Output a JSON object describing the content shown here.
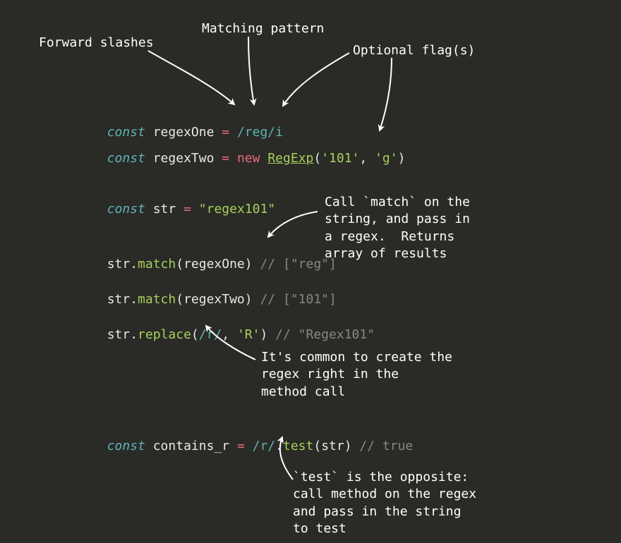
{
  "labels": {
    "forward_slashes": "Forward slashes",
    "matching_pattern": "Matching pattern",
    "optional_flags": "Optional flag(s)",
    "match_note": "Call `match` on the\nstring, and pass in\na regex.  Returns\narray of results",
    "inline_note": "It's common to create the\nregex right in the\nmethod call",
    "test_note": "`test` is the opposite:\ncall method on the regex\nand pass in the string\nto test"
  },
  "code": {
    "const": "const",
    "regexOne": "regexOne",
    "regexTwo": "regexTwo",
    "eq": "=",
    "regex_lit_1": "/reg/i",
    "new": "new",
    "RegExp": "RegExp",
    "lp": "(",
    "rp": ")",
    "comma": ", ",
    "s101": "'101'",
    "sg": "'g'",
    "strVar": "str",
    "strVal": "\"regex101\"",
    "dot": ".",
    "match": "match",
    "replace": "replace",
    "test": "test",
    "regex_r": "/r/",
    "sR": "'R'",
    "c_reg": "// [\"reg\"]",
    "c_101": "// [\"101\"]",
    "c_Regex": "// \"Regex101\"",
    "contains_r": "contains_r",
    "c_true": "// true"
  }
}
